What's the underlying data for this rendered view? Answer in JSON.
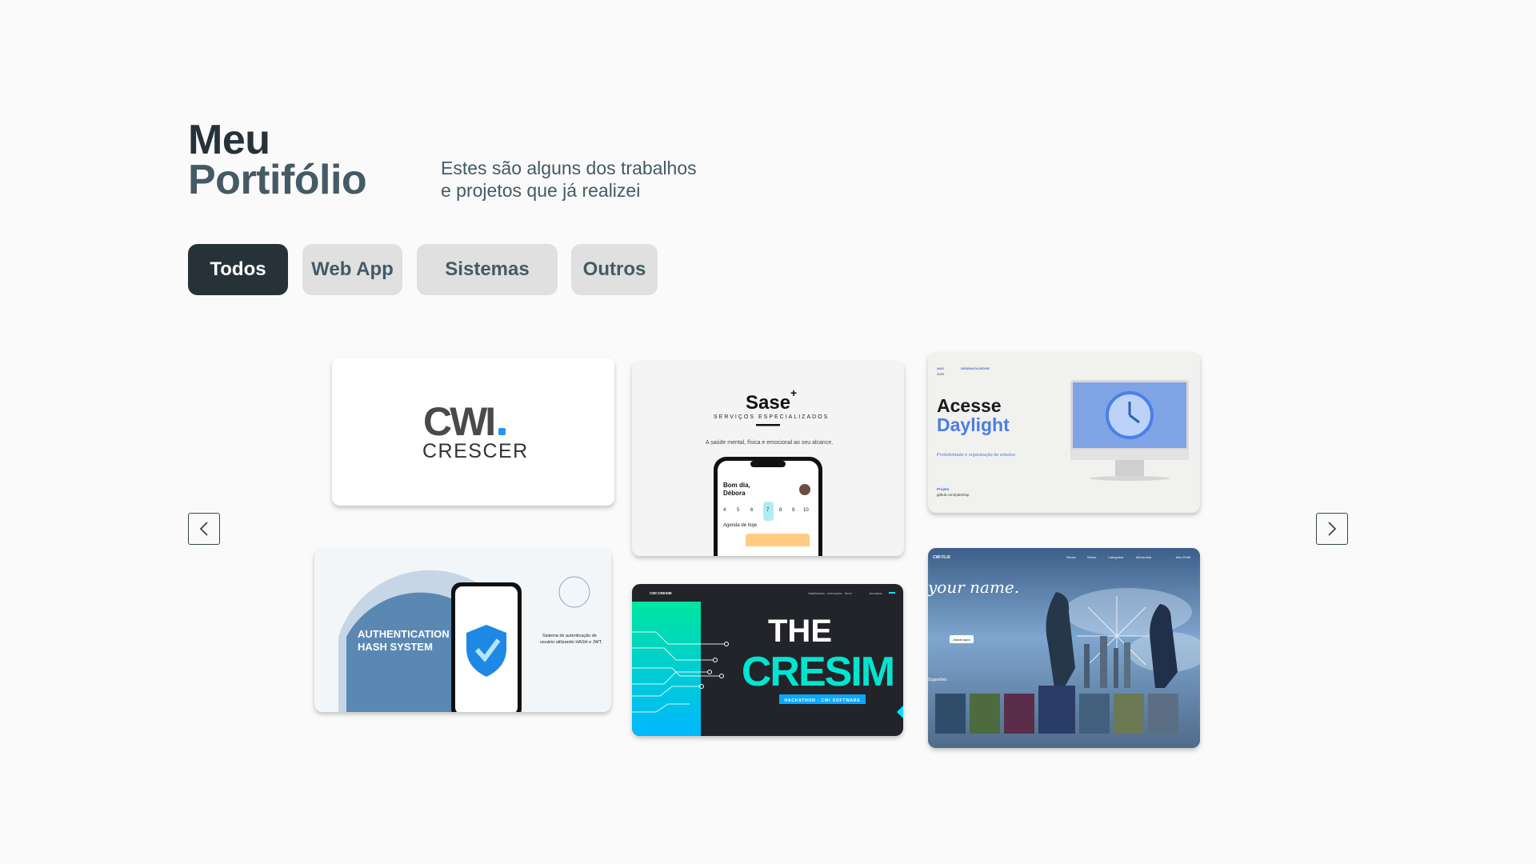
{
  "header": {
    "title_line1": "Meu",
    "title_line2": "Portifólio",
    "subtitle_line1": "Estes são alguns dos trabalhos",
    "subtitle_line2": "e  projetos que já realizei"
  },
  "filters": [
    {
      "label": "Todos",
      "active": true
    },
    {
      "label": "Web App",
      "active": false
    },
    {
      "label": "Sistemas",
      "active": false
    },
    {
      "label": "Outros",
      "active": false
    }
  ],
  "carousel": {
    "prev_icon": "chevron-left-icon",
    "next_icon": "chevron-right-icon"
  },
  "projects": {
    "cwi": {
      "logo_text": "CWI",
      "caption": "CRESCER"
    },
    "sase": {
      "brand": "Sase",
      "plus": "+",
      "tagline": "SERVIÇOS ESPECIALIZADOS",
      "description": "A saúde mental, física e emocional ao seu alcance.",
      "greeting_line1": "Bom dia,",
      "greeting_line2": "Débora",
      "days": [
        "4",
        "5",
        "6",
        "7",
        "8",
        "9",
        "10"
      ],
      "agenda": "Agenda de hoje"
    },
    "daylight": {
      "year_label": "ANO",
      "year": "2025",
      "dev_label": "DESENVOLVEDOR",
      "title_line1": "Acesse",
      "title_line2": "Daylight",
      "description": "Produtividade e organização de estudos",
      "project_label": "Projeto",
      "project_link": "github.com/pdemlop"
    },
    "auth": {
      "title_line1": "AUTHENTICATION",
      "title_line2": "HASH SYSTEM",
      "description_line1": "Sistema de autenticação de",
      "description_line2": "usuário utilizando HASH e JWT."
    },
    "cresim": {
      "brand": "CWI CRESIM",
      "nav": [
        "Habilidades",
        "Interações",
        "Itens",
        "Jornadas"
      ],
      "title_line1": "THE",
      "title_line2": "CRESIM",
      "badge": "HACKATHON - CWI SOFTWARE"
    },
    "yourname": {
      "brand": "CWI FLIX",
      "nav": [
        "Filmes",
        "Séries",
        "Categorias",
        "Minha lista",
        "Meu Perfil"
      ],
      "title": "your name.",
      "button": "Assistir agora",
      "section": "Sugestões"
    }
  },
  "colors": {
    "primary_dark": "#263238",
    "secondary": "#455a64",
    "filter_bg": "#e0e0e0",
    "page_bg": "#fafafa",
    "cwi_blue": "#2196f3",
    "cresim_cyan": "#00e5ff",
    "auth_blue": "#5b87b3"
  }
}
